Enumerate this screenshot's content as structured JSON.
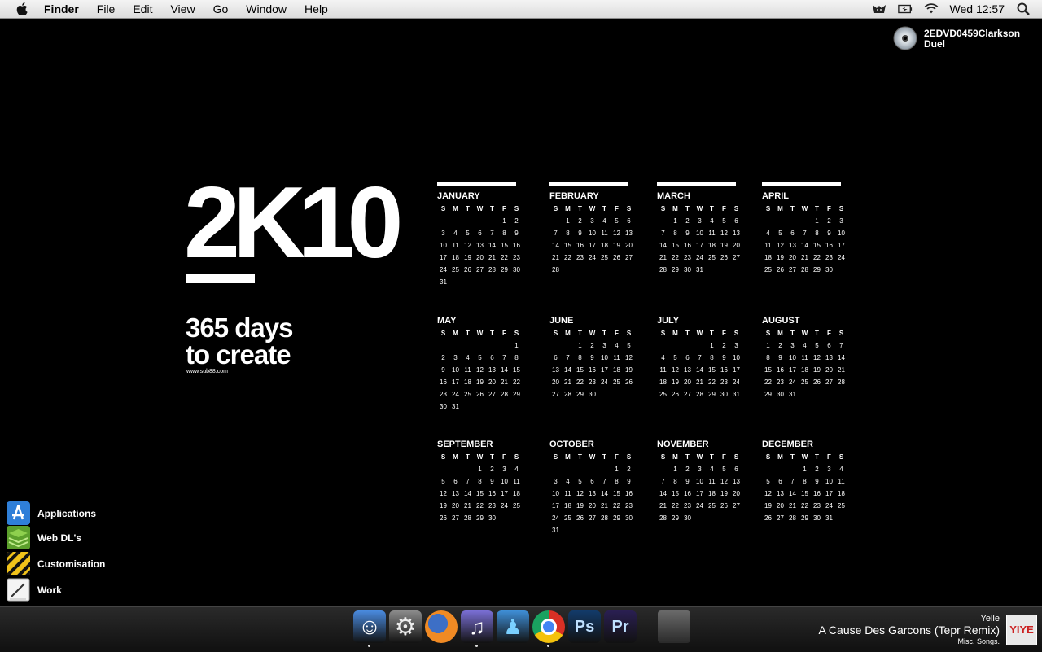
{
  "menubar": {
    "app_name": "Finder",
    "menus": [
      "File",
      "Edit",
      "View",
      "Go",
      "Window",
      "Help"
    ],
    "clock": "Wed 12:57"
  },
  "desktop": {
    "disc_label_line1": "2EDVD0459Clarkson",
    "disc_label_line2": "Duel"
  },
  "wallpaper": {
    "big_text": "2K10",
    "tagline_line1": "365 days",
    "tagline_line2": "to create",
    "site": "www.sub88.com",
    "weekdays": [
      "S",
      "M",
      "T",
      "W",
      "T",
      "F",
      "S"
    ],
    "months": [
      {
        "name": "JANUARY",
        "start": 5,
        "days": 31
      },
      {
        "name": "FEBRUARY",
        "start": 1,
        "days": 28
      },
      {
        "name": "MARCH",
        "start": 1,
        "days": 31
      },
      {
        "name": "APRIL",
        "start": 4,
        "days": 30
      },
      {
        "name": "MAY",
        "start": 6,
        "days": 31
      },
      {
        "name": "JUNE",
        "start": 2,
        "days": 30
      },
      {
        "name": "JULY",
        "start": 4,
        "days": 31
      },
      {
        "name": "AUGUST",
        "start": 0,
        "days": 31
      },
      {
        "name": "SEPTEMBER",
        "start": 3,
        "days": 30
      },
      {
        "name": "OCTOBER",
        "start": 5,
        "days": 31
      },
      {
        "name": "NOVEMBER",
        "start": 1,
        "days": 30
      },
      {
        "name": "DECEMBER",
        "start": 3,
        "days": 31
      }
    ]
  },
  "stacks": [
    {
      "label": "Applications",
      "icon": "app-store-icon"
    },
    {
      "label": "Web DL's",
      "icon": "green-stack-icon"
    },
    {
      "label": "Customisation",
      "icon": "hazard-stripes-icon"
    },
    {
      "label": "Work",
      "icon": "notepad-icon"
    }
  ],
  "dock": [
    {
      "name": "finder",
      "icon": "finder-icon",
      "color": "#4a8be0",
      "running": true
    },
    {
      "name": "system-preferences",
      "icon": "gear-icon",
      "color": "#8c8c8c",
      "running": false
    },
    {
      "name": "firefox",
      "icon": "firefox-icon",
      "color": "#e66a1c",
      "running": false
    },
    {
      "name": "itunes",
      "icon": "itunes-icon",
      "color": "#7a6fd6",
      "running": true
    },
    {
      "name": "messenger",
      "icon": "messenger-icon",
      "color": "#3f8fd8",
      "running": false
    },
    {
      "name": "chrome",
      "icon": "chrome-icon",
      "color": "#d9362c",
      "running": true
    },
    {
      "name": "photoshop",
      "icon": "photoshop-icon",
      "color": "#123b6a",
      "label": "Ps",
      "running": false
    },
    {
      "name": "premiere",
      "icon": "premiere-icon",
      "color": "#2a1f52",
      "label": "Pr",
      "running": false
    },
    {
      "name": "trash",
      "icon": "trash-icon",
      "color": "#555555",
      "running": false
    }
  ],
  "now_playing": {
    "artist": "Yelle",
    "title": "A Cause Des Garcons (Tepr Remix)",
    "album": "Misc. Songs.",
    "art_text": "YIYE"
  }
}
